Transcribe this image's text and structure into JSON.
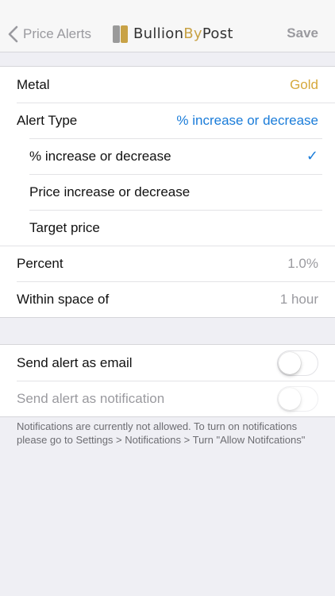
{
  "nav": {
    "back_label": "Price Alerts",
    "logo_prefix": "Bullion",
    "logo_by": "By",
    "logo_suffix": "Post",
    "save_label": "Save"
  },
  "settings": {
    "metal": {
      "label": "Metal",
      "value": "Gold"
    },
    "alert_type": {
      "label": "Alert Type",
      "value": "% increase or decrease"
    },
    "options": [
      {
        "label": "% increase or decrease",
        "selected": true
      },
      {
        "label": "Price increase or decrease",
        "selected": false
      },
      {
        "label": "Target price",
        "selected": false
      }
    ],
    "percent": {
      "label": "Percent",
      "value": "1.0%"
    },
    "within": {
      "label": "Within space of",
      "value": "1 hour"
    }
  },
  "alerts": {
    "email": {
      "label": "Send alert as email",
      "on": false
    },
    "notification": {
      "label": "Send alert as notification",
      "on": false,
      "enabled": false
    }
  },
  "footnote": "Notifications are currently not allowed. To turn on notifications please go to Settings > Notifications > Turn \"Allow Notifcations\"",
  "colors": {
    "accent_blue": "#1a7cd9",
    "gold": "#d6a83b",
    "background": "#efeff4"
  }
}
